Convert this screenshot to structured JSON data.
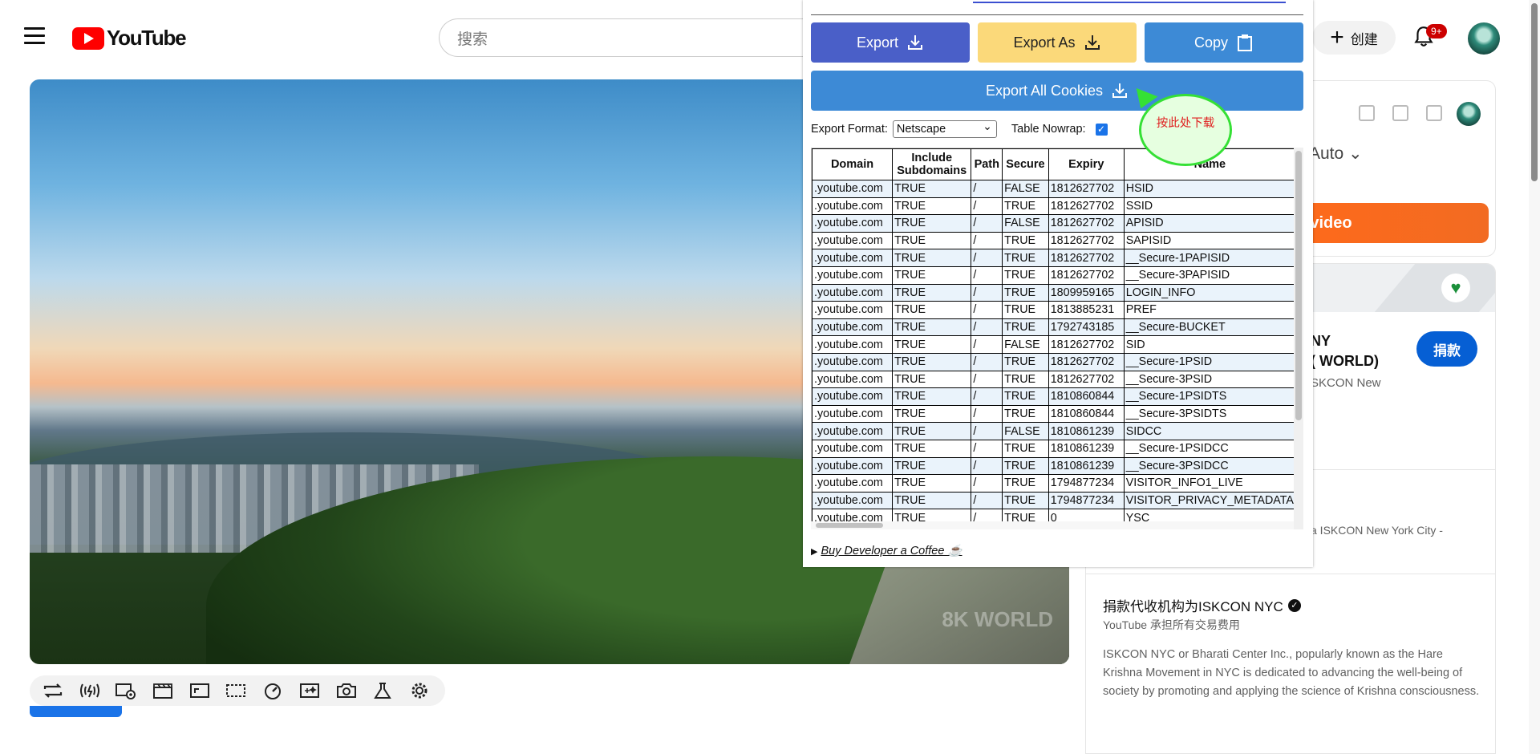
{
  "header": {
    "logo_text": "YouTube",
    "search_placeholder": "搜索",
    "create_label": "创建",
    "notification_count": "9+"
  },
  "video": {
    "watermark": "8K WORLD"
  },
  "sidebar": {
    "quality_label": "Auto",
    "orange_button": "te video",
    "org_title_line1": "NY",
    "org_title_line2": "( WORLD)",
    "org_subtitle": "SKCON New",
    "donate_label": "捐款",
    "desc_line": "a ISKCON New York City -",
    "nonprofit_title": "捐款代收机构为ISKCON NYC",
    "nonprofit_sub": "YouTube 承担所有交易费用",
    "nonprofit_desc": "ISKCON NYC or Bharati Center Inc., popularly known as the Hare Krishna Movement in NYC is dedicated to advancing the well-being of society by promoting and applying the science of Krishna consciousness."
  },
  "popup": {
    "export_label": "Export",
    "export_as_label": "Export As",
    "copy_label": "Copy",
    "export_all_label": "Export All Cookies",
    "format_label": "Export Format:",
    "format_value": "Netscape",
    "nowrap_label": "Table Nowrap:",
    "nowrap_checked": true,
    "tooltip_text": "按此处下载",
    "coffee_label": "Buy Developer a Coffee ☕"
  },
  "cookie_table": {
    "headers": [
      "Domain",
      "Include Subdomains",
      "Path",
      "Secure",
      "Expiry",
      "Name"
    ],
    "rows": [
      [
        ".youtube.com",
        "TRUE",
        "/",
        "FALSE",
        "1812627702",
        "HSID"
      ],
      [
        ".youtube.com",
        "TRUE",
        "/",
        "TRUE",
        "1812627702",
        "SSID"
      ],
      [
        ".youtube.com",
        "TRUE",
        "/",
        "FALSE",
        "1812627702",
        "APISID"
      ],
      [
        ".youtube.com",
        "TRUE",
        "/",
        "TRUE",
        "1812627702",
        "SAPISID"
      ],
      [
        ".youtube.com",
        "TRUE",
        "/",
        "TRUE",
        "1812627702",
        "__Secure-1PAPISID"
      ],
      [
        ".youtube.com",
        "TRUE",
        "/",
        "TRUE",
        "1812627702",
        "__Secure-3PAPISID"
      ],
      [
        ".youtube.com",
        "TRUE",
        "/",
        "TRUE",
        "1809959165",
        "LOGIN_INFO"
      ],
      [
        ".youtube.com",
        "TRUE",
        "/",
        "TRUE",
        "1813885231",
        "PREF"
      ],
      [
        ".youtube.com",
        "TRUE",
        "/",
        "TRUE",
        "1792743185",
        "__Secure-BUCKET"
      ],
      [
        ".youtube.com",
        "TRUE",
        "/",
        "FALSE",
        "1812627702",
        "SID"
      ],
      [
        ".youtube.com",
        "TRUE",
        "/",
        "TRUE",
        "1812627702",
        "__Secure-1PSID"
      ],
      [
        ".youtube.com",
        "TRUE",
        "/",
        "TRUE",
        "1812627702",
        "__Secure-3PSID"
      ],
      [
        ".youtube.com",
        "TRUE",
        "/",
        "TRUE",
        "1810860844",
        "__Secure-1PSIDTS"
      ],
      [
        ".youtube.com",
        "TRUE",
        "/",
        "TRUE",
        "1810860844",
        "__Secure-3PSIDTS"
      ],
      [
        ".youtube.com",
        "TRUE",
        "/",
        "FALSE",
        "1810861239",
        "SIDCC"
      ],
      [
        ".youtube.com",
        "TRUE",
        "/",
        "TRUE",
        "1810861239",
        "__Secure-1PSIDCC"
      ],
      [
        ".youtube.com",
        "TRUE",
        "/",
        "TRUE",
        "1810861239",
        "__Secure-3PSIDCC"
      ],
      [
        ".youtube.com",
        "TRUE",
        "/",
        "TRUE",
        "1794877234",
        "VISITOR_INFO1_LIVE"
      ],
      [
        ".youtube.com",
        "TRUE",
        "/",
        "TRUE",
        "1794877234",
        "VISITOR_PRIVACY_METADATA"
      ],
      [
        ".youtube.com",
        "TRUE",
        "/",
        "TRUE",
        "0",
        "YSC"
      ]
    ]
  },
  "player_toolbar": {
    "icons": [
      "loop-icon",
      "audio-icon",
      "screen-watch-icon",
      "clapper-icon",
      "aspect-icon",
      "subtitle-icon",
      "speed-icon",
      "magic-plus-icon",
      "screenshot-icon",
      "lab-icon",
      "settings-icon"
    ]
  },
  "colors": {
    "youtube_red": "#ff0000",
    "export_btn": "#4a5fc8",
    "export_as_btn": "#fbd97a",
    "copy_btn": "#3d8ad6",
    "donate_btn": "#065fd4"
  }
}
